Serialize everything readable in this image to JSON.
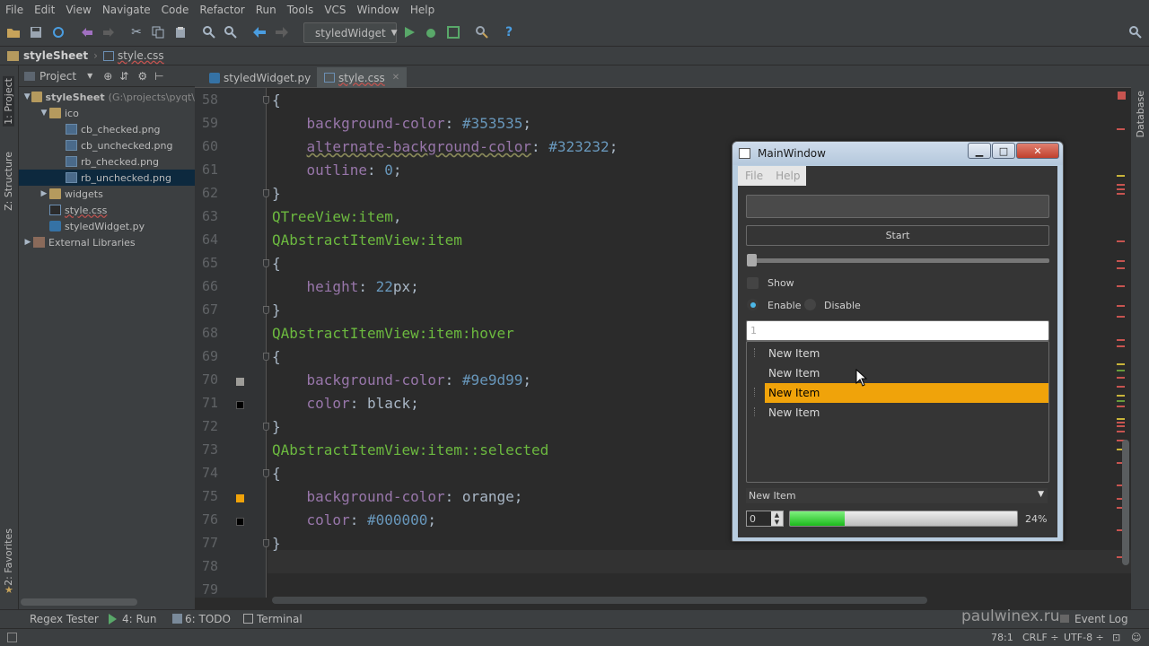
{
  "menu": [
    "File",
    "Edit",
    "View",
    "Navigate",
    "Code",
    "Refactor",
    "Run",
    "Tools",
    "VCS",
    "Window",
    "Help"
  ],
  "toolbar": {
    "run_config": "styledWidget"
  },
  "breadcrumb": {
    "project": "styleSheet",
    "file": "style.css"
  },
  "side_tabs": {
    "project": "1: Project",
    "structure": "Z: Structure",
    "favorites": "2: Favorites",
    "database": "Database"
  },
  "project_panel": {
    "title": "Project",
    "tree": [
      {
        "label": "styleSheet",
        "extra": "(G:\\projects\\pyqt\\",
        "icon": "folder",
        "depth": 0,
        "arrow": "▼"
      },
      {
        "label": "ico",
        "icon": "folder",
        "depth": 1,
        "arrow": "▼"
      },
      {
        "label": "cb_checked.png",
        "icon": "png",
        "depth": 2,
        "arrow": ""
      },
      {
        "label": "cb_unchecked.png",
        "icon": "png",
        "depth": 2,
        "arrow": ""
      },
      {
        "label": "rb_checked.png",
        "icon": "png",
        "depth": 2,
        "arrow": ""
      },
      {
        "label": "rb_unchecked.png",
        "icon": "png",
        "depth": 2,
        "arrow": "",
        "selected": true
      },
      {
        "label": "widgets",
        "icon": "folder",
        "depth": 1,
        "arrow": "▶"
      },
      {
        "label": "style.css",
        "icon": "css",
        "depth": 1,
        "arrow": ""
      },
      {
        "label": "styledWidget.py",
        "icon": "py",
        "depth": 1,
        "arrow": ""
      },
      {
        "label": "External Libraries",
        "icon": "lib",
        "depth": 0,
        "arrow": "▶"
      }
    ]
  },
  "editor": {
    "tabs": [
      {
        "label": "styledWidget.py",
        "active": false
      },
      {
        "label": "style.css",
        "active": true
      }
    ],
    "lines": [
      {
        "n": "58",
        "parts": [
          {
            "t": "{",
            "c": "kw"
          }
        ]
      },
      {
        "n": "59",
        "parts": [
          {
            "t": "    background-color",
            "c": "prop"
          },
          {
            "t": ": ",
            "c": "kw"
          },
          {
            "t": "#353535",
            "c": "val"
          },
          {
            "t": ";",
            "c": "kw"
          }
        ]
      },
      {
        "n": "60",
        "parts": [
          {
            "t": "    ",
            "c": "kw"
          },
          {
            "t": "alternate-background-color",
            "c": "prop-w"
          },
          {
            "t": ": ",
            "c": "kw"
          },
          {
            "t": "#323232",
            "c": "val"
          },
          {
            "t": ";",
            "c": "kw"
          }
        ]
      },
      {
        "n": "61",
        "parts": [
          {
            "t": "    outline",
            "c": "prop"
          },
          {
            "t": ": ",
            "c": "kw"
          },
          {
            "t": "0",
            "c": "val"
          },
          {
            "t": ";",
            "c": "kw"
          }
        ]
      },
      {
        "n": "62",
        "parts": [
          {
            "t": "}",
            "c": "kw"
          }
        ]
      },
      {
        "n": "63",
        "parts": [
          {
            "t": "QTreeView:item",
            "c": "sel-c"
          },
          {
            "t": ",",
            "c": "kw"
          }
        ]
      },
      {
        "n": "64",
        "parts": [
          {
            "t": "QAbstractItemView:item",
            "c": "sel-c"
          }
        ]
      },
      {
        "n": "65",
        "parts": [
          {
            "t": "{",
            "c": "kw"
          }
        ]
      },
      {
        "n": "66",
        "parts": [
          {
            "t": "    height",
            "c": "prop"
          },
          {
            "t": ": ",
            "c": "kw"
          },
          {
            "t": "22",
            "c": "val"
          },
          {
            "t": "px;",
            "c": "kw"
          }
        ]
      },
      {
        "n": "67",
        "parts": [
          {
            "t": "}",
            "c": "kw"
          }
        ]
      },
      {
        "n": "68",
        "parts": [
          {
            "t": "QAbstractItemView:item:hover",
            "c": "sel-c"
          }
        ]
      },
      {
        "n": "69",
        "parts": [
          {
            "t": "{",
            "c": "kw"
          }
        ]
      },
      {
        "n": "70",
        "parts": [
          {
            "t": "    background-color",
            "c": "prop"
          },
          {
            "t": ": ",
            "c": "kw"
          },
          {
            "t": "#9e9d99",
            "c": "val"
          },
          {
            "t": ";",
            "c": "kw"
          }
        ]
      },
      {
        "n": "71",
        "parts": [
          {
            "t": "    color",
            "c": "prop"
          },
          {
            "t": ": ",
            "c": "kw"
          },
          {
            "t": "black",
            "c": "kw"
          },
          {
            "t": ";",
            "c": "kw"
          }
        ]
      },
      {
        "n": "72",
        "parts": [
          {
            "t": "}",
            "c": "kw"
          }
        ]
      },
      {
        "n": "73",
        "parts": [
          {
            "t": "QAbstractItemView:item::selected",
            "c": "sel-c"
          }
        ]
      },
      {
        "n": "74",
        "parts": [
          {
            "t": "{",
            "c": "kw"
          }
        ]
      },
      {
        "n": "75",
        "parts": [
          {
            "t": "    background-color",
            "c": "prop"
          },
          {
            "t": ": ",
            "c": "kw"
          },
          {
            "t": "orange",
            "c": "kw"
          },
          {
            "t": ";",
            "c": "kw"
          }
        ]
      },
      {
        "n": "76",
        "parts": [
          {
            "t": "    color",
            "c": "prop"
          },
          {
            "t": ": ",
            "c": "kw"
          },
          {
            "t": "#000000",
            "c": "val"
          },
          {
            "t": ";",
            "c": "kw"
          }
        ]
      },
      {
        "n": "77",
        "parts": [
          {
            "t": "}",
            "c": "kw"
          }
        ]
      },
      {
        "n": "78",
        "parts": []
      },
      {
        "n": "79",
        "parts": []
      }
    ],
    "swatches": [
      {
        "line": "70",
        "color": "#9e9d99"
      },
      {
        "line": "71",
        "color": "#000000"
      },
      {
        "line": "75",
        "color": "#f0a30a"
      },
      {
        "line": "76",
        "color": "#000000"
      }
    ]
  },
  "qt_window": {
    "title": "MainWindow",
    "menu": [
      "File",
      "Help"
    ],
    "start_button": "Start",
    "checkbox_show": "Show",
    "radio_enable": "Enable",
    "radio_disable": "Disable",
    "line_edit_value": "1",
    "list_items": [
      {
        "label": "New Item",
        "state": "normal"
      },
      {
        "label": "New Item",
        "state": "normal"
      },
      {
        "label": "New Item",
        "state": "selected"
      },
      {
        "label": "New Item",
        "state": "normal"
      }
    ],
    "combo_value": "New Item",
    "spin_value": "0",
    "progress_percent": 24,
    "progress_label": "24%",
    "selected_color": "#f0a30a"
  },
  "status": {
    "regex": "Regex Tester",
    "run": "4: Run",
    "todo": "6: TODO",
    "terminal": "Terminal",
    "watermark": "paulwinex.ru",
    "event_log": "Event Log",
    "position": "78:1",
    "line_sep": "CRLF ÷",
    "encoding": "UTF-8 ÷"
  }
}
